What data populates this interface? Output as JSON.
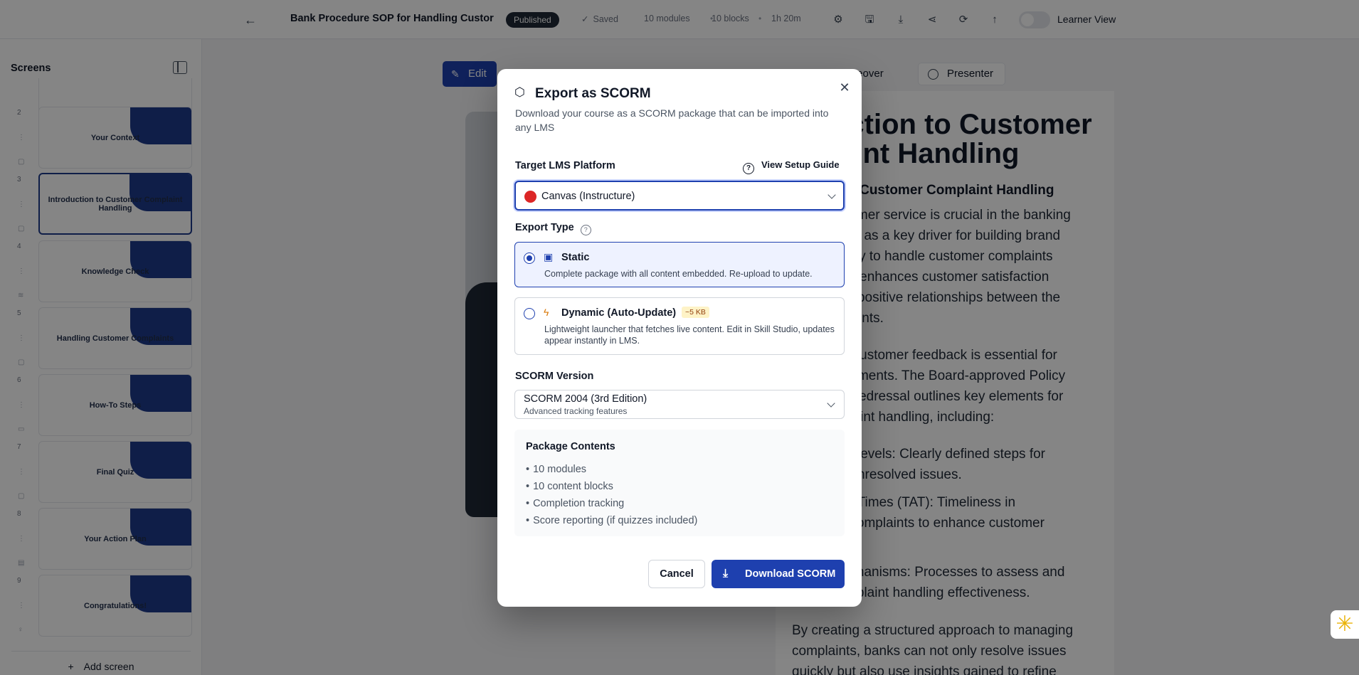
{
  "topbar": {
    "course_title": "Bank Procedure SOP for Handling Custor",
    "status_badge": "Published",
    "saved_label": "Saved",
    "modules": "10 modules",
    "blocks": "10 blocks",
    "duration": "1h 20m",
    "learner_view_label": "Learner View",
    "icons": [
      "back-arrow-icon",
      "gear-icon",
      "save-icon",
      "download-icon",
      "share-icon",
      "refresh-icon",
      "upload-icon"
    ]
  },
  "sidebar": {
    "title": "Screens",
    "add_screen": "Add screen",
    "screens": [
      {
        "num": "2",
        "label": "Your Context"
      },
      {
        "num": "3",
        "label": "Introduction to Customer Complaint Handling"
      },
      {
        "num": "4",
        "label": "Knowledge Check"
      },
      {
        "num": "5",
        "label": "Handling Customer Complaints"
      },
      {
        "num": "6",
        "label": "How-To Steps"
      },
      {
        "num": "7",
        "label": "Final Quiz"
      },
      {
        "num": "8",
        "label": "Your Action Plan"
      },
      {
        "num": "9",
        "label": "Congratulations!"
      }
    ]
  },
  "canvas": {
    "edit_label": "Edit",
    "voiceover_label": "piceover",
    "presenter_label": "Presenter",
    "heading": "uction to Customer\nlaint Handling",
    "subheading": "n to Customer Complaint Handling",
    "p1": "ustomer service is crucial in the banking\nrving as a key driver for building brand\nability to handle customer complaints\nonly enhances customer satisfaction\nters positive relationships between the\ns clients.",
    "p2": "ing customer feedback is essential for\nrovements. The Board-approved Policy\nce Redressal outlines key elements for\nmplaint handling, including:",
    "p3": "ion Levels: Clearly defined steps for\nng unresolved issues.",
    "p4": "und Times (TAT): Timeliness in\nng complaints to enhance customer",
    "p5": "Mechanisms: Processes to assess and\ncomplaint handling effectiveness.",
    "p6": "By creating a structured approach to managing\ncomplaints, banks can not only resolve issues\nquickly but also use insights gained to refine"
  },
  "modal": {
    "title": "Export as SCORM",
    "description": "Download your course as a SCORM package that can be imported into any LMS",
    "lms_label": "Target LMS Platform",
    "setup_guide": "View Setup Guide",
    "lms_value": "Canvas (Instructure)",
    "export_type_label": "Export Type",
    "options": [
      {
        "name": "Static",
        "desc": "Complete package with all content embedded. Re-upload to update.",
        "selected": true
      },
      {
        "name": "Dynamic (Auto-Update)",
        "tag": "~5 KB",
        "desc": "Lightweight launcher that fetches live content. Edit in Skill Studio, updates appear instantly in LMS.",
        "selected": false
      }
    ],
    "version_label": "SCORM Version",
    "version_value": "SCORM 2004 (3rd Edition)",
    "version_sub": "Advanced tracking features",
    "package": {
      "title": "Package Contents",
      "items": [
        "10 modules",
        "10 content blocks",
        "Completion tracking",
        "Score reporting (if quizzes included)"
      ]
    },
    "cancel": "Cancel",
    "download": "Download SCORM"
  },
  "colors": {
    "accent": "#1e40af",
    "thumb_blob": "#1e3a8a",
    "canvas_lms_dot": "#dc2626",
    "tag_bg": "#fef3c7"
  }
}
